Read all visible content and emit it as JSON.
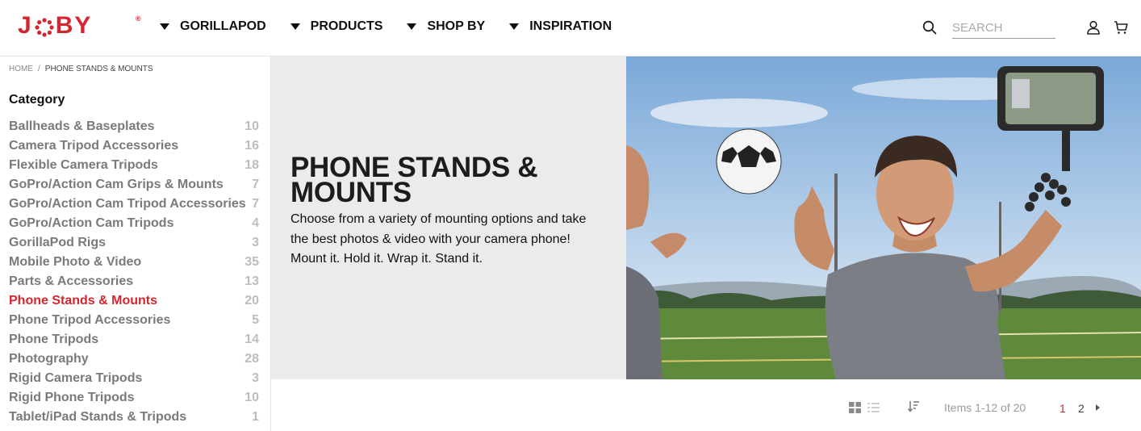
{
  "brand": {
    "logo_text_left": "J",
    "logo_text_right": "BY",
    "registered": "®",
    "color": "#d22630"
  },
  "nav": [
    {
      "label": "GORILLAPOD"
    },
    {
      "label": "PRODUCTS"
    },
    {
      "label": "SHOP BY"
    },
    {
      "label": "INSPIRATION"
    }
  ],
  "search": {
    "placeholder": "SEARCH",
    "icon": "search-icon"
  },
  "header_icons": {
    "account": "user-icon",
    "cart": "cart-icon"
  },
  "breadcrumb": {
    "home": "HOME",
    "separator": "/",
    "current": "PHONE STANDS & MOUNTS"
  },
  "sidebar": {
    "title": "Category",
    "items": [
      {
        "label": "Ballheads & Baseplates",
        "count": "10"
      },
      {
        "label": "Camera Tripod Accessories",
        "count": "16"
      },
      {
        "label": "Flexible Camera Tripods",
        "count": "18"
      },
      {
        "label": "GoPro/Action Cam Grips & Mounts",
        "count": "7"
      },
      {
        "label": "GoPro/Action Cam Tripod Accessories",
        "count": "7"
      },
      {
        "label": "GoPro/Action Cam Tripods",
        "count": "4"
      },
      {
        "label": "GorillaPod Rigs",
        "count": "3"
      },
      {
        "label": "Mobile Photo & Video",
        "count": "35"
      },
      {
        "label": "Parts & Accessories",
        "count": "13"
      },
      {
        "label": "Phone Stands & Mounts",
        "count": "20",
        "active": true
      },
      {
        "label": "Phone Tripod Accessories",
        "count": "5"
      },
      {
        "label": "Phone Tripods",
        "count": "14"
      },
      {
        "label": "Photography",
        "count": "28"
      },
      {
        "label": "Rigid Camera Tripods",
        "count": "3"
      },
      {
        "label": "Rigid Phone Tripods",
        "count": "10"
      },
      {
        "label": "Tablet/iPad Stands & Tripods",
        "count": "1"
      }
    ]
  },
  "hero": {
    "title": "PHONE STANDS & MOUNTS",
    "description": "Choose from a variety of mounting options and take the best photos & video with your camera phone! Mount it. Hold it. Wrap it. Stand it.",
    "image": "soccer-selfie-photo",
    "background": "#ebebeb"
  },
  "toolbar": {
    "view_grid_icon": "grid-view-icon",
    "view_list_icon": "list-view-icon",
    "sort_icon": "sort-icon",
    "items_text": "Items 1-12 of 20",
    "pages": [
      "1",
      "2"
    ],
    "current_page": "1",
    "next_icon": "next-page-icon"
  }
}
